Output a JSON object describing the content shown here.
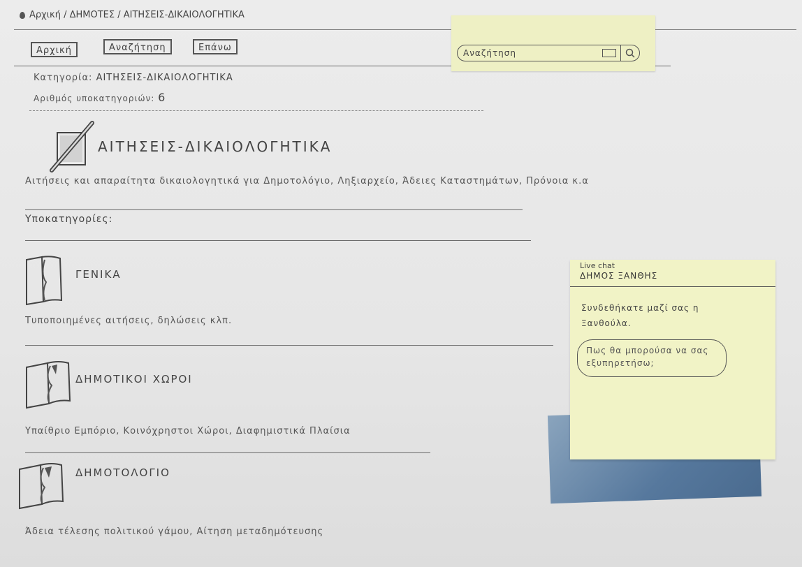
{
  "breadcrumb": {
    "text": "Αρχική / ΔΗΜΟΤΕΣ / ΑΙΤΗΣΕΙΣ-ΔΙΚΑΙΟΛΟΓΗΤΙΚΑ"
  },
  "nav": {
    "home_label": "Αρχική",
    "search_label": "Αναζήτηση",
    "back_label": "Επάνω"
  },
  "search": {
    "placeholder": "Αναζήτηση"
  },
  "category": {
    "label": "Κατηγορία:",
    "name": "ΑΙΤΗΣΕΙΣ-ΔΙΚΑΙΟΛΟΓΗΤΙΚΑ",
    "count_label": "Αριθμός υποκατηγοριών:",
    "count": "6",
    "title": "ΑΙΤΗΣΕΙΣ-ΔΙΚΑΙΟΛΟΓΗΤΙΚΑ",
    "description": "Αιτήσεις και απαραίτητα δικαιολογητικά για Δημοτολόγιο, Ληξιαρχείο, Άδειες Καταστημάτων, Πρόνοια κ.α"
  },
  "subcategories_label": "Υποκατηγορίες:",
  "subcategories": [
    {
      "title": "ΓΕΝΙΚΑ",
      "description": "Τυποποιημένες αιτήσεις, δηλώσεις κλπ."
    },
    {
      "title": "ΔΗΜΟΤΙΚΟΙ ΧΩΡΟΙ",
      "description": "Υπαίθριο Εμπόριο, Κοινόχρηστοι Χώροι, Διαφημιστικά Πλαίσια"
    },
    {
      "title": "ΔΗΜΟΤΟΛΟΓΙΟ",
      "description": "Άδεια τέλεσης πολιτικού γάμου, Αίτηση μεταδημότευσης"
    }
  ],
  "live_chat": {
    "label": "Live chat",
    "title": "ΔΗΜΟΣ ΞΑΝΘΗΣ",
    "message": "Συνδεθήκατε μαζί σας η Ξανθούλα.",
    "prompt": "Πως θα μπορούσα να σας εξυπηρετήσω;"
  },
  "colors": {
    "sticky_yellow": "#eef0c4",
    "sticky_blue": "#56789d"
  },
  "icons": [
    "map-pin-icon",
    "search-icon",
    "pencil-square-icon",
    "book-icon"
  ]
}
